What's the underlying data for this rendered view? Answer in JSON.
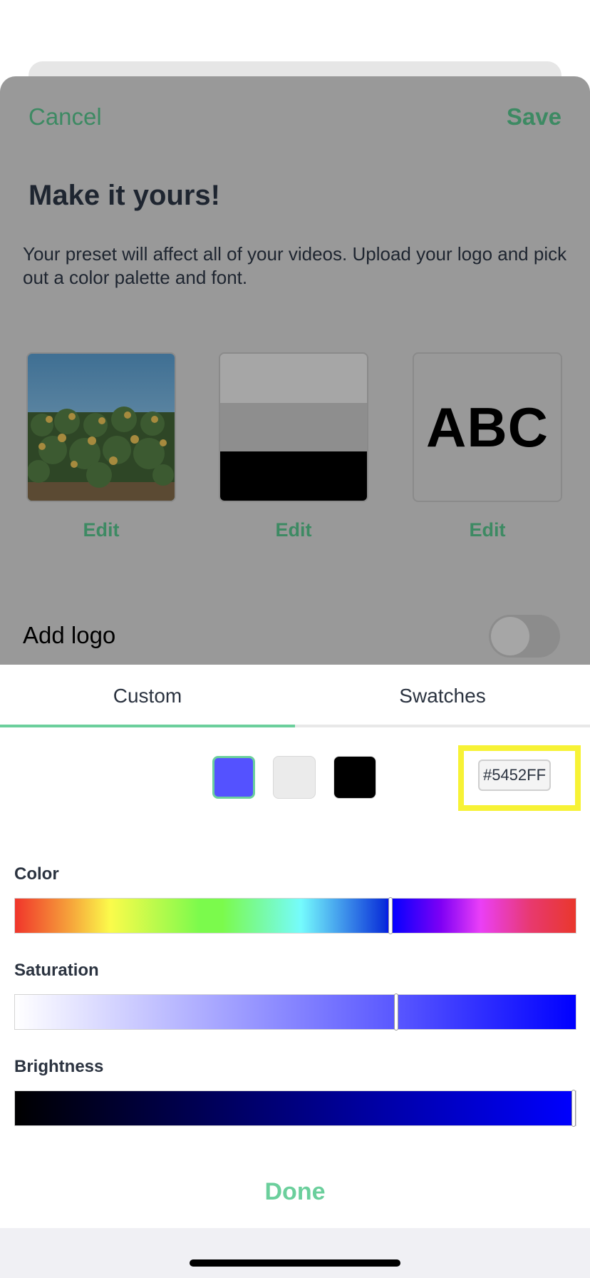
{
  "header": {
    "cancel_label": "Cancel",
    "save_label": "Save"
  },
  "preset": {
    "title": "Make it yours!",
    "description": "Your preset will affect all of your videos. Upload your logo and pick out a color palette and font.",
    "tiles": [
      {
        "name": "logo",
        "edit_label": "Edit"
      },
      {
        "name": "color-palette",
        "edit_label": "Edit",
        "colors": [
          "#a6a6a6",
          "#8e8e8e",
          "#000000"
        ]
      },
      {
        "name": "font",
        "edit_label": "Edit",
        "sample_text": "ABC"
      }
    ],
    "add_logo_label": "Add logo",
    "add_logo_enabled": false
  },
  "picker": {
    "tabs": [
      {
        "label": "Custom",
        "active": true
      },
      {
        "label": "Swatches",
        "active": false
      }
    ],
    "swatches": [
      {
        "color": "#5452FF",
        "selected": true
      },
      {
        "color": "#EBEBEB",
        "selected": false
      },
      {
        "color": "#000000",
        "selected": false
      }
    ],
    "hex_value": "#5452FF",
    "sliders": [
      {
        "label": "Color",
        "value_fraction": 0.67
      },
      {
        "label": "Saturation",
        "value_fraction": 0.68
      },
      {
        "label": "Brightness",
        "value_fraction": 1.0
      }
    ],
    "done_label": "Done"
  },
  "colors": {
    "accent_green": "#3d8a63",
    "mint": "#6bcf9c",
    "highlight_yellow": "#f7f235"
  }
}
